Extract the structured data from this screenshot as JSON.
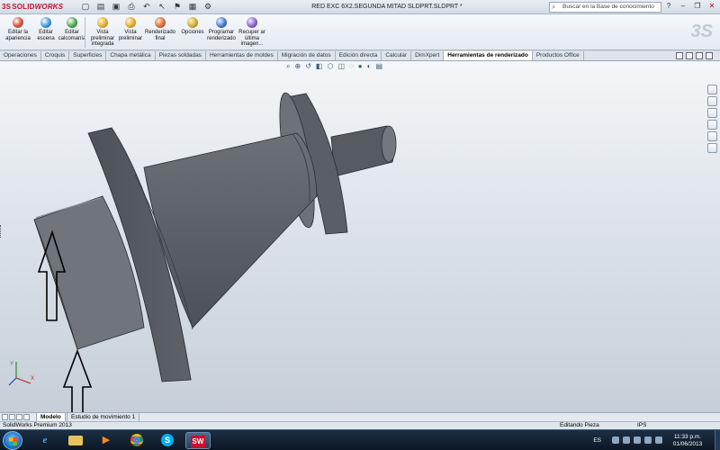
{
  "app": {
    "logo_prefix": "3S",
    "logo_solid": "SOLID",
    "logo_works": "WORKS",
    "window_title": "RED EXC 6X2.SEGUNDA MITAD SLDPRT.SLDPRT *"
  },
  "search": {
    "placeholder": "Buscar en la Base de conocimiento"
  },
  "ribbon": {
    "buttons": [
      {
        "label": "Editar la apariencia",
        "icon": "appearance-icon",
        "color": "#d84a2b"
      },
      {
        "label": "Editar escena",
        "icon": "scene-icon",
        "color": "#2f8fd8"
      },
      {
        "label": "Editar calcomanía",
        "icon": "decal-icon",
        "color": "#3f9f3f"
      },
      {
        "label": "Vista preliminar integrada",
        "icon": "integrated-preview-icon",
        "color": "#e2a21e"
      },
      {
        "label": "Vista preliminar",
        "icon": "preview-icon",
        "color": "#e2a21e"
      },
      {
        "label": "Renderizado final",
        "icon": "final-render-icon",
        "color": "#d8622b"
      },
      {
        "label": "Opciones",
        "icon": "options-icon",
        "color": "#c8a52e"
      },
      {
        "label": "Programar renderizado",
        "icon": "schedule-render-icon",
        "color": "#3a72c8"
      },
      {
        "label": "Recuper ar última imagen...",
        "icon": "recover-image-icon",
        "color": "#7a5cc8"
      }
    ]
  },
  "tabs": [
    {
      "label": "Operaciones"
    },
    {
      "label": "Croquis"
    },
    {
      "label": "Superficies"
    },
    {
      "label": "Chapa metálica"
    },
    {
      "label": "Piezas soldadas"
    },
    {
      "label": "Herramientas de moldes"
    },
    {
      "label": "Migración de datos"
    },
    {
      "label": "Edición directa"
    },
    {
      "label": "Calcular"
    },
    {
      "label": "DimXpert"
    },
    {
      "label": "Herramientas de renderizado",
      "active": true
    },
    {
      "label": "Productos Office"
    }
  ],
  "bottom_tabs": [
    {
      "label": "Modelo"
    },
    {
      "label": "Estudio de movimiento 1"
    }
  ],
  "status": {
    "product": "SolidWorks Premium 2013",
    "mode": "Editando Pieza",
    "units": "IPS"
  },
  "taskbar": {
    "language": "ES",
    "time": "11:33 p.m.",
    "date": "01/06/2013"
  },
  "colors": {
    "part_face_dark": "#54585f",
    "part_face_mid": "#70747b",
    "part_face_light": "#9ca0a7"
  }
}
